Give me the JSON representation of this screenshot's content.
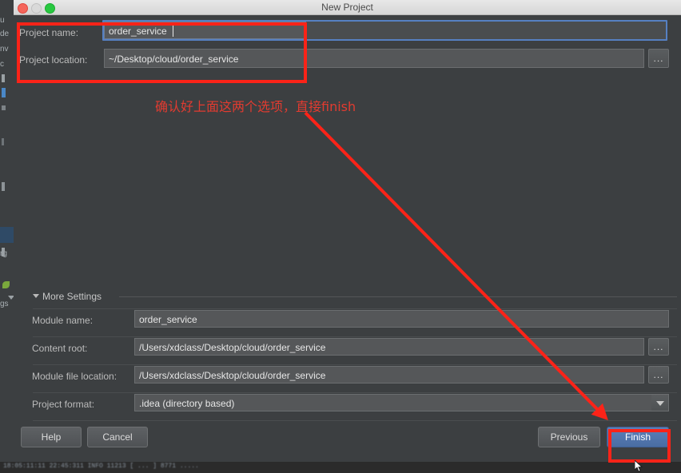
{
  "window": {
    "title": "New Project",
    "controls": {
      "close": "close-button",
      "minimize": "minimize-button",
      "maximize": "maximize-button"
    }
  },
  "form": {
    "project_name": {
      "label": "Project name:",
      "value": "order_service",
      "focused": true
    },
    "project_location": {
      "label": "Project location:",
      "value": "~/Desktop/cloud/order_service",
      "browse_label": "..."
    }
  },
  "more_settings": {
    "section_label": "More Settings",
    "expanded": true,
    "fields": [
      {
        "label": "Module name:",
        "value": "order_service",
        "has_browse": false
      },
      {
        "label": "Content root:",
        "value": "/Users/xdclass/Desktop/cloud/order_service",
        "has_browse": true,
        "browse_label": "..."
      },
      {
        "label": "Module file location:",
        "value": "/Users/xdclass/Desktop/cloud/order_service",
        "has_browse": true,
        "browse_label": "..."
      },
      {
        "label": "Project format:",
        "value": ".idea (directory based)",
        "is_dropdown": true
      }
    ]
  },
  "footer": {
    "help_label": "Help",
    "cancel_label": "Cancel",
    "previous_label": "Previous",
    "finish_label": "Finish"
  },
  "annotations": {
    "note_text": "确认好上面这两个选项，直接finish",
    "highlight_color": "#fb2318",
    "note_color": "#e23b30",
    "boxes": [
      {
        "name": "fields-highlight"
      },
      {
        "name": "finish-highlight"
      }
    ]
  },
  "ide_background": {
    "left_fragments": [
      "u",
      "de",
      "nv",
      "c",
      "rg",
      "gs"
    ],
    "bottom_log_text": "18:05:11:11 22:45:311  INFO  11213       [ ...  ]  8771      ....."
  },
  "colors": {
    "dialog_bg": "#3c3f41",
    "field_bg": "#555759",
    "accent_blue": "#5680c2",
    "primary_button": "#4a6da3",
    "annotation_red": "#fb2318",
    "title_bar": "#e0e0e0"
  }
}
